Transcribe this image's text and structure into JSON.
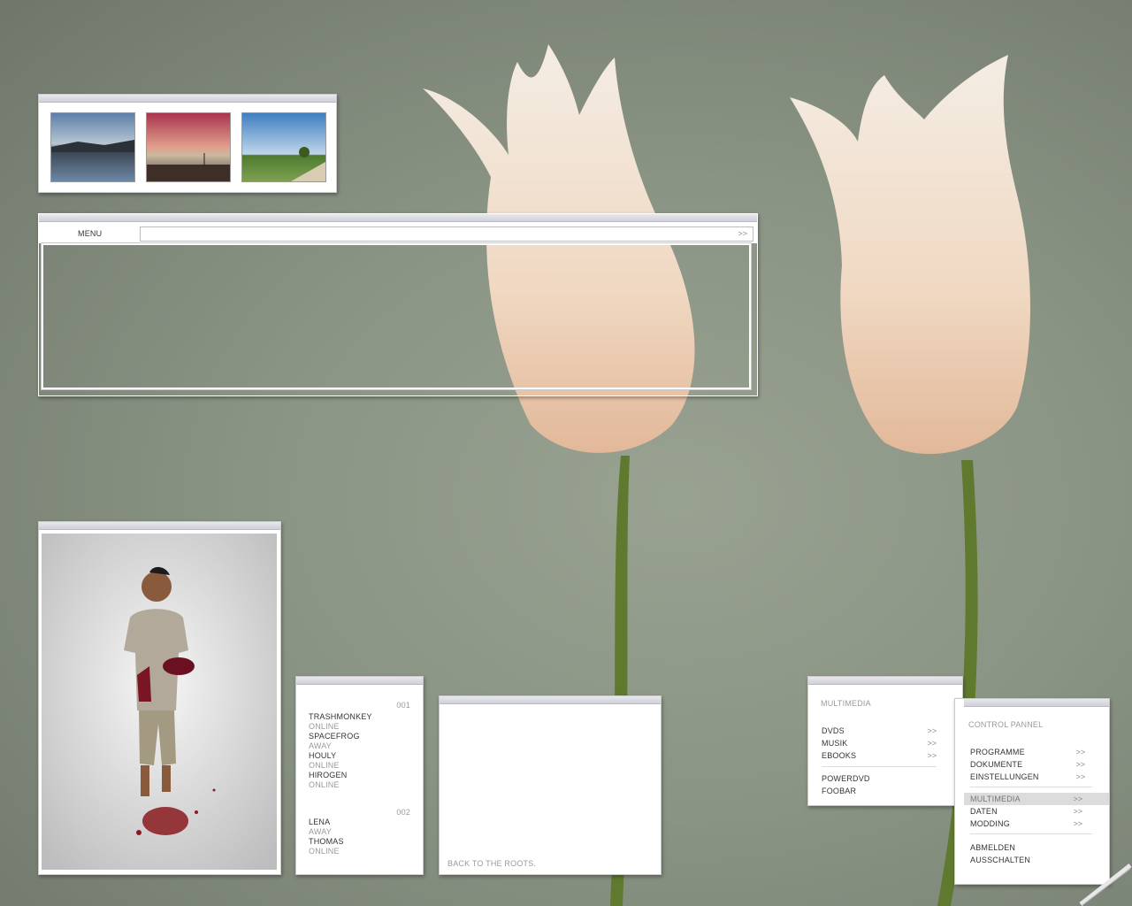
{
  "gallery": {
    "thumbnails": [
      "landscape-lake-icon",
      "landscape-sunset-icon",
      "landscape-field-icon"
    ]
  },
  "menu": {
    "label": "MENU",
    "go": ">>"
  },
  "contacts": {
    "group1": {
      "number": "001",
      "items": [
        {
          "name": "TRASHMONKEY",
          "status": "ONLINE"
        },
        {
          "name": "SPACEFROG",
          "status": "AWAY"
        },
        {
          "name": "HOULY",
          "status": "ONLINE"
        },
        {
          "name": "HIROGEN",
          "status": "ONLINE"
        }
      ]
    },
    "group2": {
      "number": "002",
      "items": [
        {
          "name": "LENA",
          "status": "AWAY"
        },
        {
          "name": "THOMAS",
          "status": "ONLINE"
        }
      ]
    }
  },
  "notes": {
    "text": "BACK TO THE ROOTS."
  },
  "multimedia": {
    "title": "MULTIMEDIA",
    "items": [
      {
        "label": "DVDS",
        "arrow": ">>"
      },
      {
        "label": "MUSIK",
        "arrow": ">>"
      },
      {
        "label": "EBOOKS",
        "arrow": ">>"
      }
    ],
    "apps": [
      "POWERDVD",
      "FOOBAR"
    ]
  },
  "control": {
    "title": "CONTROL PANNEL",
    "group1": [
      {
        "label": "PROGRAMME",
        "arrow": ">>"
      },
      {
        "label": "DOKUMENTE",
        "arrow": ">>"
      },
      {
        "label": "EINSTELLUNGEN",
        "arrow": ">>"
      }
    ],
    "group2": [
      {
        "label": "MULTIMEDIA",
        "arrow": ">>",
        "selected": true
      },
      {
        "label": "DATEN",
        "arrow": ">>"
      },
      {
        "label": "MODDING",
        "arrow": ">>"
      }
    ],
    "group3": [
      "ABMELDEN",
      "AUSSCHALTEN"
    ]
  }
}
